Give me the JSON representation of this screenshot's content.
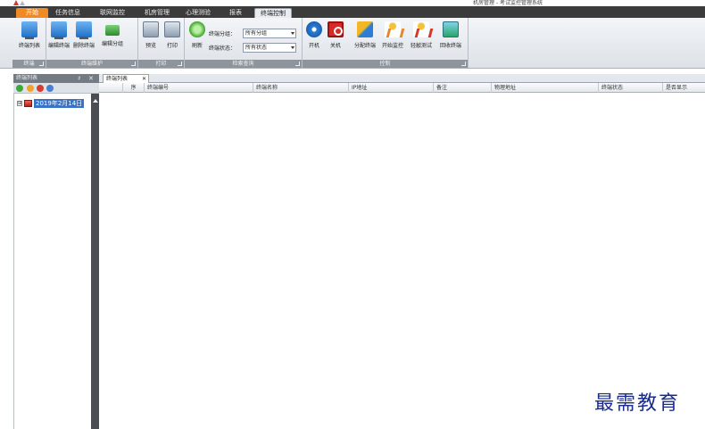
{
  "window": {
    "title": "机房管理 - 考试监控管理系统"
  },
  "tabs": [
    {
      "id": "start",
      "label": "开始"
    },
    {
      "id": "task",
      "label": "任务信息"
    },
    {
      "id": "monitor",
      "label": "联网监控"
    },
    {
      "id": "lab",
      "label": "机房管理"
    },
    {
      "id": "mind",
      "label": "心理测验"
    },
    {
      "id": "report",
      "label": "报表"
    },
    {
      "id": "terminal",
      "label": "终端控制"
    }
  ],
  "ribbon": {
    "groups": [
      {
        "label": "终端"
      },
      {
        "label": "终端维护"
      },
      {
        "label": "打印"
      },
      {
        "label": "检索查询"
      },
      {
        "label": "控制"
      }
    ],
    "buttons": {
      "terminal_list": "终端列表",
      "edit_terminal": "编辑终端",
      "delete_terminal": "删除终端",
      "edit_group": "编辑分组",
      "preview": "预览",
      "print": "打印",
      "refresh": "刷新",
      "power_on": "开机",
      "power_off": "关机",
      "distribute": "分配终端",
      "start_monitor": "开始监控",
      "tap_test": "轻敲测试",
      "recover": "回收终端"
    },
    "filters": {
      "group_label": "终端分组：",
      "group_value": "所有分组",
      "status_label": "终端状态：",
      "status_value": "所有状态"
    }
  },
  "left_panel": {
    "title": "终端列表",
    "pin": "♯",
    "close": "✕",
    "tree": [
      {
        "label": "2019年2月14日",
        "expander": "⊞"
      }
    ]
  },
  "main": {
    "doc_tab": {
      "label": "终端列表",
      "close": "✕"
    },
    "columns": [
      "序",
      "终端编号",
      "终端名称",
      "IP地址",
      "备注",
      "物理地址",
      "终端状态",
      "是否显示"
    ]
  },
  "watermark": "最需教育",
  "colors": {
    "start_tab": "#f08a24",
    "tree_selected": "#3a72c4",
    "watermark": "#1b2b8a"
  }
}
